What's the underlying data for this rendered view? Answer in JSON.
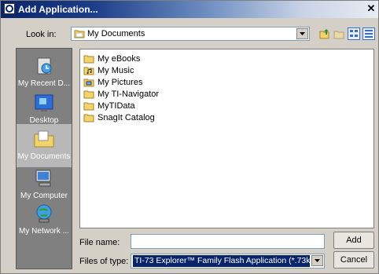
{
  "window": {
    "title": "Add Application..."
  },
  "toolbar": {
    "look_in_label": "Look in:",
    "look_in_value": "My Documents"
  },
  "places": [
    {
      "label": "My Recent D...",
      "icon": "recent-documents-icon"
    },
    {
      "label": "Desktop",
      "icon": "desktop-icon"
    },
    {
      "label": "My Documents",
      "icon": "my-documents-icon",
      "selected": true
    },
    {
      "label": "My Computer",
      "icon": "my-computer-icon"
    },
    {
      "label": "My Network ...",
      "icon": "my-network-icon"
    }
  ],
  "files": [
    {
      "name": "My eBooks",
      "icon": "folder-icon"
    },
    {
      "name": "My Music",
      "icon": "music-folder-icon"
    },
    {
      "name": "My Pictures",
      "icon": "pictures-folder-icon"
    },
    {
      "name": "My TI-Navigator",
      "icon": "folder-icon"
    },
    {
      "name": "MyTIData",
      "icon": "folder-icon"
    },
    {
      "name": "SnagIt Catalog",
      "icon": "folder-icon"
    }
  ],
  "form": {
    "file_name_label": "File name:",
    "file_name_value": "",
    "files_of_type_label": "Files of type:",
    "files_of_type_value": "TI-73 Explorer™ Family Flash Application (*.73k)"
  },
  "buttons": {
    "add": "Add",
    "cancel": "Cancel"
  },
  "colors": {
    "title_bar": "#0a246a",
    "selection": "#0a246a",
    "places_bg": "#808080"
  }
}
